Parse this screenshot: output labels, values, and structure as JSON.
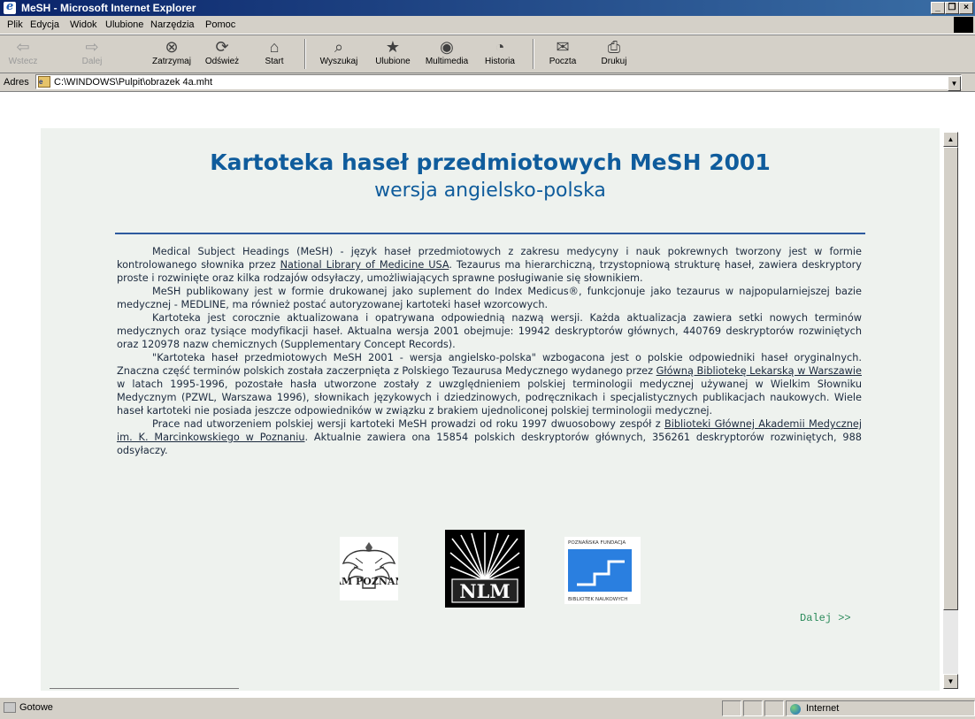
{
  "window": {
    "title": "MeSH - Microsoft Internet Explorer",
    "controls": [
      "_",
      "❐",
      "×"
    ]
  },
  "menu": [
    "Plik",
    "Edycja",
    "Widok",
    "Ulubione",
    "Narzędzia",
    "Pomoc"
  ],
  "toolbar": {
    "back": "Wstecz",
    "forward": "Dalej",
    "stop": "Zatrzymaj",
    "refresh": "Odśwież",
    "home": "Start",
    "search": "Wyszukaj",
    "favorites": "Ulubione",
    "media": "Multimedia",
    "history": "Historia",
    "mail": "Poczta",
    "print": "Drukuj"
  },
  "address": {
    "label": "Adres",
    "url": "C:\\WINDOWS\\Pulpit\\obrazek 4a.mht"
  },
  "page": {
    "title": "Kartoteka haseł przedmiotowych MeSH 2001",
    "subtitle": "wersja angielsko-polska",
    "p1_before": "Medical Subject Headings (MeSH) - język haseł przedmiotowych z zakresu medycyny i nauk pokrewnych tworzony jest w formie kontrolowanego słownika przez ",
    "p1_link": "National Library of Medicine USA",
    "p1_after": ". Tezaurus ma hierarchiczną, trzystopniową strukturę haseł, zawiera deskryptory proste i rozwinięte oraz kilka rodzajów odsyłaczy, umożliwiających sprawne posługiwanie się słownikiem.",
    "p2": "MeSH publikowany jest w formie drukowanej jako suplement do Index Medicus®, funkcjonuje jako tezaurus w najpopularniejszej bazie medycznej - MEDLINE, ma również postać autoryzowanej kartoteki haseł wzorcowych.",
    "p3": "Kartoteka jest corocznie aktualizowana i opatrywana odpowiednią nazwą wersji. Każda aktualizacja zawiera setki nowych terminów medycznych oraz tysiące modyfikacji haseł. Aktualna wersja 2001 obejmuje: 19942 deskryptorów głównych, 440769 deskryptorów rozwiniętych oraz 120978 nazw chemicznych (Supplementary Concept Records).",
    "p4_before": "\"Kartoteka haseł przedmiotowych MeSH 2001 - wersja angielsko-polska\" wzbogacona jest o polskie odpowiedniki haseł oryginalnych. Znaczna część terminów polskich została zaczerpnięta z Polskiego Tezaurusa Medycznego wydanego przez ",
    "p4_link": "Główną Bibliotekę Lekarską w Warszawie",
    "p4_after": " w latach 1995-1996, pozostałe hasła utworzone zostały z uwzględnieniem polskiej terminologii medycznej używanej w Wielkim Słowniku Medycznym (PZWL, Warszawa 1996), słownikach językowych i dziedzinowych, podręcznikach i specjalistycznych publikacjach naukowych. Wiele haseł kartoteki nie posiada jeszcze odpowiedników w związku z brakiem ujednoliconej polskiej terminologii medycznej.",
    "p5_before": "Prace nad utworzeniem polskiej wersji kartoteki MeSH prowadzi od roku 1997 dwuosobowy zespół z ",
    "p5_link": "Biblioteki Głównej Akademii Medycznej im. K. Marcinkowskiego w Poznaniu",
    "p5_after": ". Aktualnie zawiera ona 15854 polskich deskryptorów głównych, 356261 deskryptorów rozwiniętych, 988 odsyłaczy.",
    "logo_am_text": "AM POZNAŃ",
    "logo_nlm_text": "NLM",
    "logo_pf_top": "POZNAŃSKA FUNDACJA",
    "logo_pf_bottom": "BIBLIOTEK NAUKOWYCH",
    "next_link": "Dalej >>"
  },
  "status": {
    "text": "Gotowe",
    "zone": "Internet"
  }
}
